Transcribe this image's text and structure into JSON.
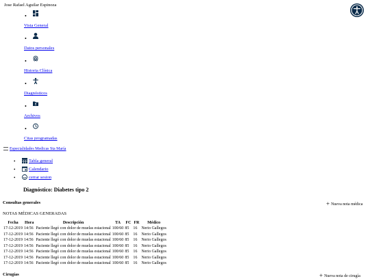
{
  "user": {
    "name": "Jose Rafael Aguilar Espinoza"
  },
  "accessibility": {
    "icon": "accessibility-icon"
  },
  "nav": [
    {
      "label": "Vista General",
      "icon": "dashboard-icon"
    },
    {
      "label": "Datos personales",
      "icon": "user-icon"
    },
    {
      "label": "Historia Clínica",
      "icon": "fingerprint-icon"
    },
    {
      "label": "Diagnósticos",
      "icon": "person-icon"
    },
    {
      "label": "Archivos",
      "icon": "folder-icon"
    },
    {
      "label": "Citas programadas",
      "icon": "clock-icon"
    }
  ],
  "brand": {
    "label": "Especialidades Medicas Sta María"
  },
  "sub_nav": [
    {
      "label": "Tabla general",
      "icon": "table-icon"
    },
    {
      "label": "Calendario",
      "icon": "calendar-icon"
    },
    {
      "label": "cerrar sesion",
      "icon": "logout-icon"
    }
  ],
  "diagnosis": {
    "title": "Diagnóstico: Diabetes tipo 2"
  },
  "consultas": {
    "section_title": "Consultas generales",
    "new_note_label": "Nueva nota médica",
    "notes_title": "NOTAS MÉDICAS GENERADAS",
    "columns": [
      "Fecha",
      "Hora",
      "Descripción",
      "TA",
      "FC",
      "FR",
      "Médico"
    ],
    "rows": [
      [
        "17-12-2019",
        "14:56",
        "Paciente llegó con dolor de muelas estacional",
        "100/60",
        "85",
        "16",
        "Nerio Gallegos"
      ],
      [
        "17-12-2019",
        "14:56",
        "Paciente llegó con dolor de muelas estacional",
        "100/60",
        "85",
        "16",
        "Nerio Gallegos"
      ],
      [
        "17-12-2019",
        "14:56",
        "Paciente llegó con dolor de muelas estacional",
        "100/60",
        "85",
        "16",
        "Nerio Gallegos"
      ],
      [
        "17-12-2019",
        "14:56",
        "Paciente llegó con dolor de muelas estacional",
        "100/60",
        "85",
        "16",
        "Nerio Gallegos"
      ],
      [
        "17-12-2019",
        "14:56",
        "Paciente llegó con dolor de muelas estacional",
        "100/60",
        "85",
        "16",
        "Nerio Gallegos"
      ],
      [
        "17-12-2019",
        "14:56",
        "Paciente llegó con dolor de muelas estacional",
        "100/60",
        "85",
        "16",
        "Nerio Gallegos"
      ],
      [
        "17-12-2019",
        "14:56",
        "Paciente llegó con dolor de muelas estacional",
        "100/60",
        "85",
        "16",
        "Nerio Gallegos"
      ]
    ]
  },
  "cirugias": {
    "section_title": "Cirugías",
    "new_label": "Nueva nota de cirugía"
  },
  "colors": {
    "link": "#0000ee",
    "icon": "#0a2b4a"
  }
}
